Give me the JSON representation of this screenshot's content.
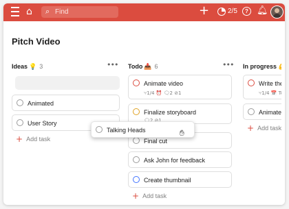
{
  "topbar": {
    "search_placeholder": "Find",
    "karma": "2/5",
    "color": "#db4c3f"
  },
  "project": {
    "title": "Pitch Video"
  },
  "columns": [
    {
      "title": "Ideas",
      "emoji": "💡",
      "count": "3",
      "tasks": [
        "Animated",
        "User Story"
      ],
      "add_label": "Add task"
    },
    {
      "title": "Todo",
      "emoji": "📥",
      "count": "6",
      "tasks": [
        {
          "label": "Animate video",
          "meta": "⑂1/4  ⏰  🗨2  ⊘1",
          "priority_color": "#db4c3f"
        },
        {
          "label": "Finalize storyboard",
          "meta": "🗨2  ⊘1",
          "priority_color": "#e0a224"
        },
        {
          "label": "Final cut"
        },
        {
          "label": "Ask John for feedback"
        },
        {
          "label": "Create thumbnail",
          "priority_color": "#4073ff"
        }
      ],
      "add_label": "Add task"
    },
    {
      "title": "In progress",
      "emoji": "💪",
      "tasks": [
        {
          "label": "Write the",
          "meta": "⑂1/4  📅 To",
          "priority_color": "#db4c3f"
        },
        {
          "label": "Animated"
        }
      ],
      "add_label": "Add task"
    }
  ],
  "dragging": {
    "label": "Talking Heads"
  }
}
